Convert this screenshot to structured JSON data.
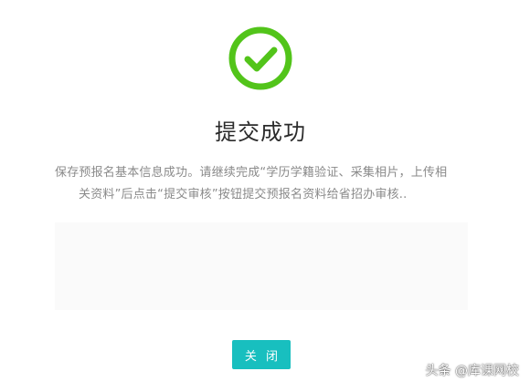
{
  "dialog": {
    "icon": "check-circle-icon",
    "title": "提交成功",
    "message_line1": "保存预报名基本信息成功。请继续完成“学历学籍验证、采集相片，上传相",
    "message_line2": "关资料”后点击“提交审核”按钮提交预报名资料给省招办审核..",
    "close_label": "关 闭"
  },
  "watermark": {
    "text": "头条 @库课网校"
  },
  "colors": {
    "success_green": "#52c41a",
    "button_teal": "#18bfbf",
    "title_text": "#2b2b2b",
    "message_text": "#8a8a8a",
    "panel_background": "#fafafa"
  }
}
